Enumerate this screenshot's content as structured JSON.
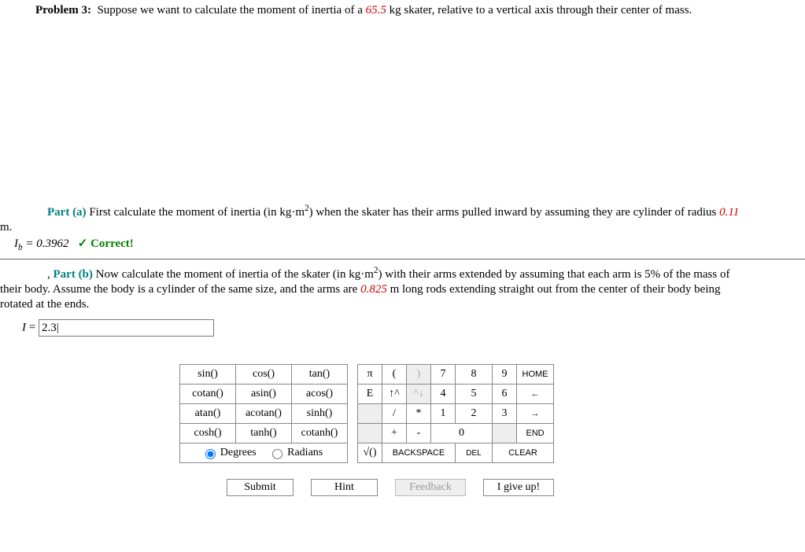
{
  "problem": {
    "label": "Problem 3:",
    "text_before": "Suppose we want to calculate the moment of inertia of a ",
    "mass_value": "65.5",
    "text_after": " kg skater, relative to a vertical axis through their center of mass."
  },
  "part_a": {
    "label": "Part (a)",
    "text_before": "First calculate the moment of inertia (in kg·m",
    "exp": "2",
    "text_mid": ") when the skater has their arms pulled inward by assuming they are cylinder of radius ",
    "radius_value": "0.11",
    "body_suffix": "m.",
    "answer_var": "I",
    "answer_sub": "b",
    "answer_eq": " = 0.3962",
    "correct_check": "✓",
    "correct_text": " Correct!"
  },
  "part_b": {
    "prefix": ", ",
    "label": "Part (b)",
    "text_before": "Now calculate the moment of inertia of the skater (in kg·m",
    "exp": "2",
    "text_mid": ") with their arms extended by assuming that each arm is 5% of the mass of",
    "line2_before": "their body. Assume the body is a cylinder of the same size, and the arms are ",
    "arm_value": "0.825",
    "line2_after": " m long rods extending straight out from the center of their body being",
    "line3": "rotated at the ends.",
    "input_label_var": "I",
    "input_label_eq": " = ",
    "input_value": "2.3|"
  },
  "keypad": {
    "func": {
      "r1": [
        "sin()",
        "cos()",
        "tan()"
      ],
      "r2": [
        "cotan()",
        "asin()",
        "acos()"
      ],
      "r3": [
        "atan()",
        "acotan()",
        "sinh()"
      ],
      "r4": [
        "cosh()",
        "tanh()",
        "cotanh()"
      ],
      "radio_deg": "Degrees",
      "radio_rad": "Radians"
    },
    "num": {
      "r1": [
        "π",
        "(",
        ")",
        "7",
        "8",
        "9",
        "HOME"
      ],
      "r2": [
        "E",
        "↑^",
        "^↓",
        "4",
        "5",
        "6",
        "←"
      ],
      "r3": [
        "",
        "/",
        "*",
        "1",
        "2",
        "3",
        "→"
      ],
      "r4": [
        "",
        "+",
        "-",
        "0",
        "",
        "END"
      ],
      "r5": [
        "√()",
        "BACKSPACE",
        "DEL",
        "CLEAR"
      ]
    }
  },
  "actions": {
    "submit": "Submit",
    "hint": "Hint",
    "feedback": "Feedback",
    "giveup": "I give up!"
  }
}
